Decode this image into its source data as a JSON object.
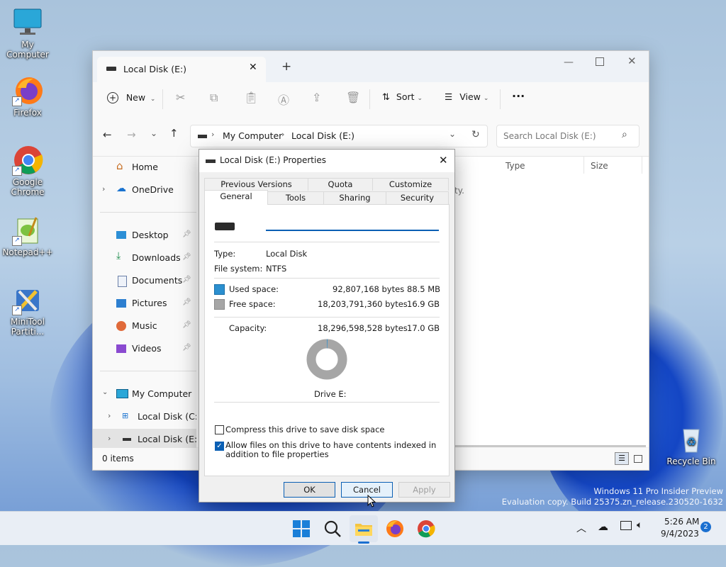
{
  "desktop": {
    "icons": [
      {
        "label": "My Computer"
      },
      {
        "label": "Firefox"
      },
      {
        "label": "Google Chrome"
      },
      {
        "label": "Notepad++"
      },
      {
        "label": "MiniTool Partiti..."
      },
      {
        "label": "Recycle Bin"
      }
    ],
    "watermark": {
      "line1": "Windows 11 Pro Insider Preview",
      "line2": "Evaluation copy. Build 25375.zn_release.230520-1632"
    }
  },
  "explorer": {
    "tab_title": "Local Disk (E:)",
    "new_tab_symbol": "+",
    "toolbar": {
      "new_label": "New",
      "sort_label": "Sort",
      "view_label": "View",
      "more_label": "···"
    },
    "breadcrumb": [
      "My Computer",
      "Local Disk (E:)"
    ],
    "search_placeholder": "Search Local Disk (E:)",
    "columns": {
      "type": "Type",
      "size": "Size"
    },
    "empty_hint_fragment": "ty.",
    "nav": {
      "home": "Home",
      "onedrive": "OneDrive",
      "desktop": "Desktop",
      "downloads": "Downloads",
      "documents": "Documents",
      "pictures": "Pictures",
      "music": "Music",
      "videos": "Videos",
      "my_computer": "My Computer",
      "local_c": "Local Disk (C:)",
      "local_e": "Local Disk (E:)"
    },
    "status": "0 items"
  },
  "dialog": {
    "title": "Local Disk (E:) Properties",
    "tabs_top": [
      "Previous Versions",
      "Quota",
      "Customize"
    ],
    "tabs_bottom": [
      "General",
      "Tools",
      "Sharing",
      "Security"
    ],
    "name_value": "",
    "type_label": "Type:",
    "type_value": "Local Disk",
    "fs_label": "File system:",
    "fs_value": "NTFS",
    "used_label": "Used space:",
    "used_bytes": "92,807,168 bytes",
    "used_human": "88.5 MB",
    "free_label": "Free space:",
    "free_bytes": "18,203,791,360 bytes",
    "free_human": "16.9 GB",
    "cap_label": "Capacity:",
    "cap_bytes": "18,296,598,528 bytes",
    "cap_human": "17.0 GB",
    "used_fraction": 0.0051,
    "drive_label": "Drive E:",
    "compress_label": "Compress this drive to save disk space",
    "compress_checked": false,
    "index_label": "Allow files on this drive to have contents indexed in addition to file properties",
    "index_checked": true,
    "ok_label": "OK",
    "cancel_label": "Cancel",
    "apply_label": "Apply",
    "colors": {
      "used": "#2b8fcf",
      "free": "#a6a6a6"
    }
  },
  "taskbar": {
    "time": "5:26 AM",
    "date": "9/4/2023",
    "notification_count": "2"
  }
}
